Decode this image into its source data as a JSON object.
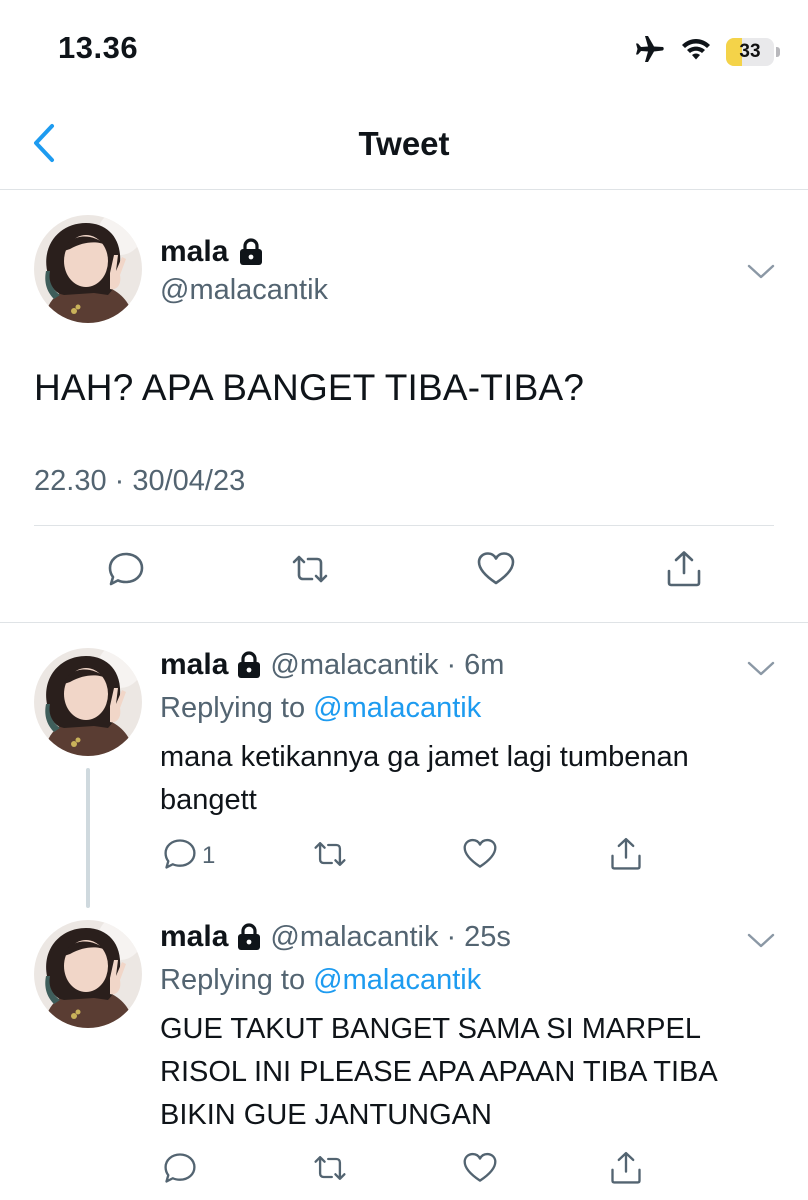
{
  "status_bar": {
    "time": "13.36",
    "battery": "33",
    "battery_level": 0.33,
    "icons": [
      "airplane-icon",
      "wifi-icon",
      "battery-icon"
    ]
  },
  "header": {
    "title": "Tweet",
    "back_icon": "chevron-left-icon"
  },
  "main_tweet": {
    "name": "mala",
    "handle": "@malacantik",
    "text": "HAH? APA BANGET TIBA-TIBA?",
    "timestamp": "22.30 · 30/04/23",
    "actions": [
      "reply-icon",
      "retweet-icon",
      "like-icon",
      "share-icon"
    ]
  },
  "replies": [
    {
      "name": "mala",
      "handle": "@malacantik",
      "separator": "·",
      "age": "6m",
      "replying_prefix": "Replying to",
      "replying_to": "@malacantik",
      "text": "mana ketikannya ga jamet lagi tumbenan bangett",
      "reply_count": "1"
    },
    {
      "name": "mala",
      "handle": "@malacantik",
      "separator": "·",
      "age": "25s",
      "replying_prefix": "Replying to",
      "replying_to": "@malacantik",
      "text": "GUE TAKUT BANGET SAMA SI MARPEL RISOL INI PLEASE APA APAAN TIBA TIBA BIKIN GUE JANTUNGAN",
      "reply_count": ""
    }
  ],
  "colors": {
    "accent": "#1d9bf0",
    "text": "#0f1419",
    "secondary": "#536471",
    "divider": "#dfe3e6",
    "battery": "#f4d349"
  }
}
